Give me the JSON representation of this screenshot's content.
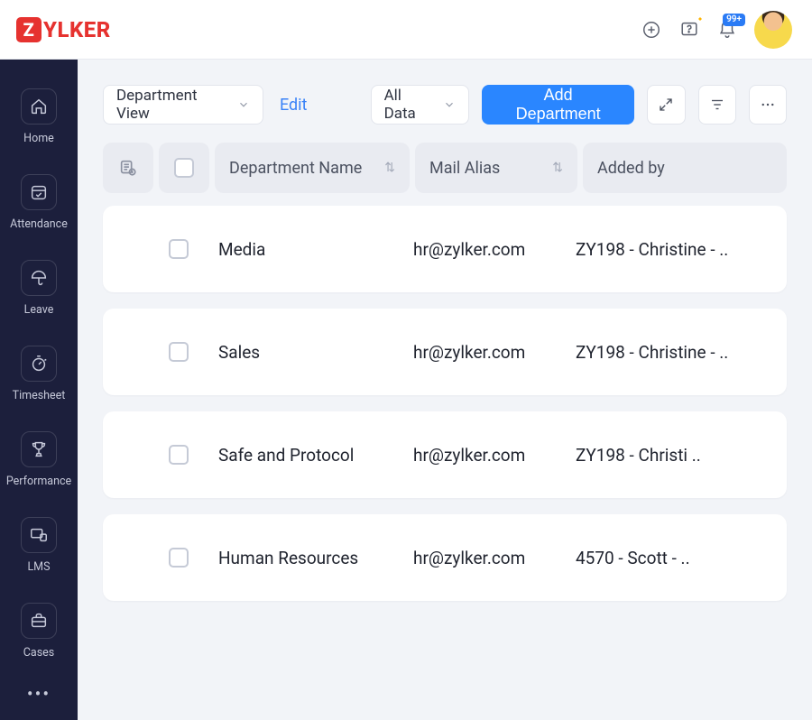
{
  "brand": {
    "letter": "Z",
    "rest": "YLKER"
  },
  "topbar": {
    "notif_badge": "99+"
  },
  "sidebar": {
    "items": [
      {
        "label": "Home"
      },
      {
        "label": "Attendance"
      },
      {
        "label": "Leave"
      },
      {
        "label": "Timesheet"
      },
      {
        "label": "Performance"
      },
      {
        "label": "LMS"
      },
      {
        "label": "Cases"
      }
    ],
    "more": "•••"
  },
  "toolbar": {
    "view_label": "Department View",
    "edit_label": "Edit",
    "filter_label": "All Data",
    "add_label": "Add Department"
  },
  "columns": {
    "name": "Department Name",
    "mail": "Mail Alias",
    "added": "Added by"
  },
  "rows": [
    {
      "name": "Media",
      "mail": "hr@zylker.com",
      "added": "ZY198 - Christine - .."
    },
    {
      "name": "Sales",
      "mail": "hr@zylker.com",
      "added": "ZY198 - Christine - .."
    },
    {
      "name": "Safe and Protocol",
      "mail": "hr@zylker.com",
      "added": "ZY198 - Christi .."
    },
    {
      "name": "Human Resources",
      "mail": "hr@zylker.com",
      "added": "4570 - Scott - .."
    }
  ]
}
